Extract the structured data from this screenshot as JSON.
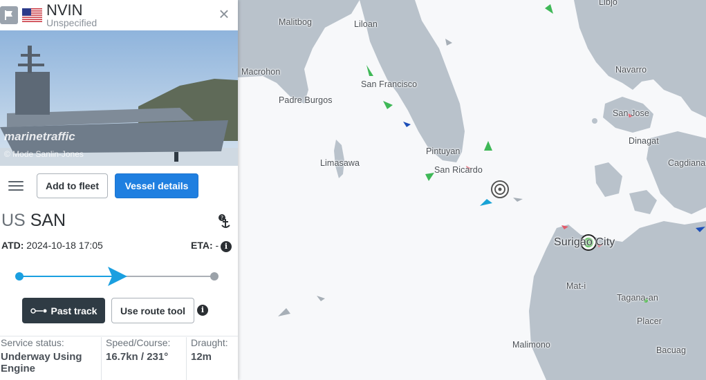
{
  "vessel": {
    "name": "NVIN",
    "type": "Unspecified",
    "callsign_country": "US",
    "callsign": "SAN",
    "atd_label": "ATD:",
    "atd_value": "2024-10-18 17:05",
    "eta_label": "ETA:",
    "eta_value": "-",
    "route_progress": 0.5
  },
  "photo": {
    "watermark": "marinetraffic",
    "credit": "© Mode Sanlin-Jones"
  },
  "actions": {
    "add_to_fleet": "Add to fleet",
    "vessel_details": "Vessel details",
    "past_track": "Past track",
    "use_route_tool": "Use route tool"
  },
  "status": {
    "service_label": "Service status:",
    "service_value": "Underway Using Engine",
    "speed_label": "Speed/Course:",
    "speed_value": "16.7kn / 231°",
    "draught_label": "Draught:",
    "draught_value": "12m"
  },
  "map": {
    "places": [
      "Libjo",
      "Malitbog",
      "Liloan",
      "Macrohon",
      "Navarro",
      "San Francisco",
      "Padre Burgos",
      "San Jose",
      "Dinagat",
      "Pintuyan",
      "Limasawa",
      "San Ricardo",
      "Cagdianao",
      "Surigao City",
      "Mat-i",
      "Tagana-an",
      "Placer",
      "Malimono",
      "Bacuag"
    ]
  },
  "colors": {
    "accent_blue": "#1f7fe0",
    "route_blue": "#1a9fe0",
    "dark_button": "#2f3b44",
    "land": "#b9c2cb",
    "sea": "#f7f8fa"
  },
  "icons": [
    "flag-icon",
    "close-icon",
    "menu-icon",
    "anchor-icon",
    "info-icon",
    "track-icon",
    "ship-arrow-icon"
  ]
}
